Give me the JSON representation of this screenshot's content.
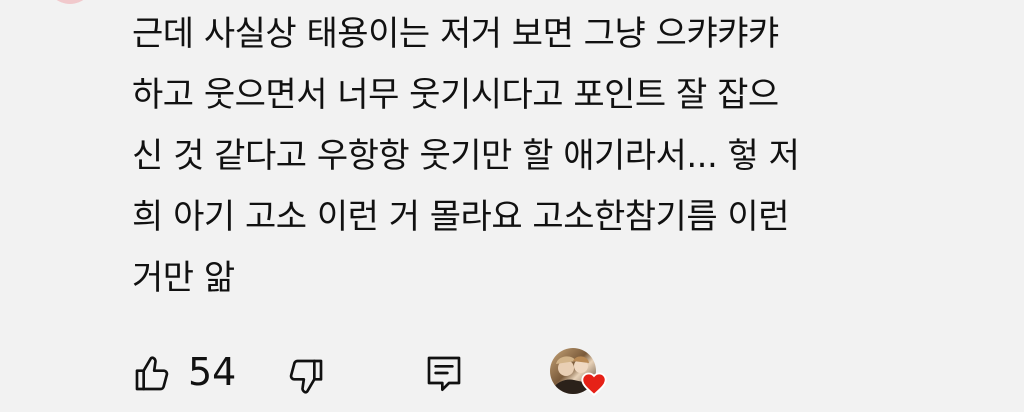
{
  "comment": {
    "text_lines": [
      "근데 사실상 태용이는 저거 보면 그냥 으캬캬캬",
      "하고 웃으면서 너무 웃기시다고 포인트 잘 잡으",
      "신 것 같다고 우항항 웃기만 할 애기라서... 헣 저",
      "희 아기 고소 이런 거 몰라요 고소한참기름 이런",
      "거만 앎"
    ]
  },
  "actions": {
    "like_icon": "thumbs-up-icon",
    "like_count": "54",
    "dislike_icon": "thumbs-down-icon",
    "reply_icon": "reply-comment-icon",
    "creator_heart_icon": "creator-heart-icon",
    "heart_color": "#e62117"
  }
}
